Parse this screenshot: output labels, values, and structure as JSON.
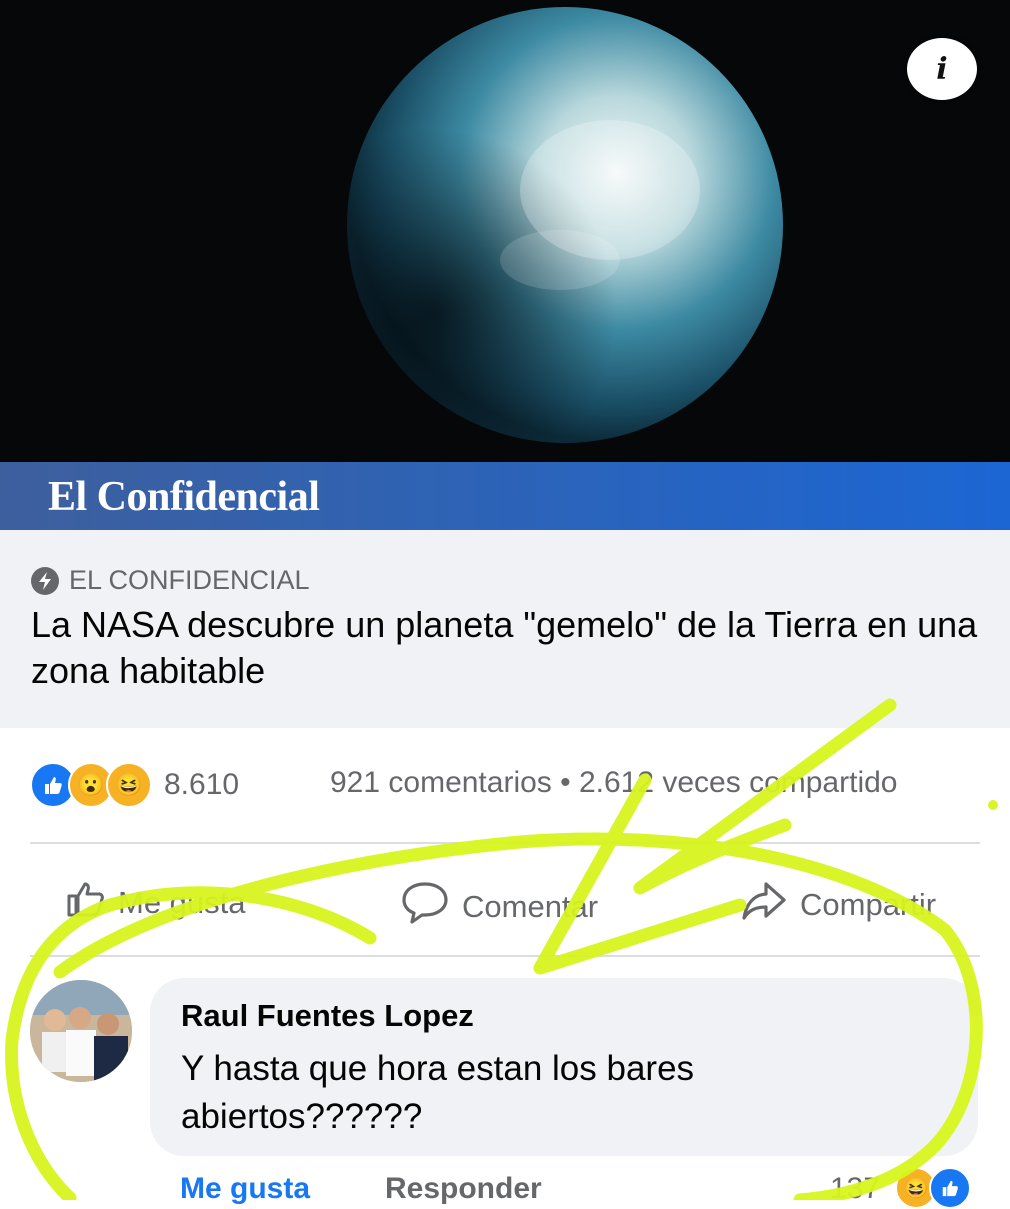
{
  "hero": {
    "info_label": "i"
  },
  "brand": {
    "name": "El Confidencial"
  },
  "link": {
    "source": "EL CONFIDENCIAL",
    "headline": "La NASA descubre un planeta \"gemelo\" de la Tierra en una zona habitable"
  },
  "stats": {
    "reaction_icons": [
      "like-icon",
      "wow-icon",
      "haha-icon"
    ],
    "reaction_count": "8.610",
    "summary": "921 comentarios • 2.612 veces compartido"
  },
  "actions": {
    "like": "Me gusta",
    "comment": "Comentar",
    "share": "Compartir"
  },
  "comment": {
    "author": "Raul Fuentes Lopez",
    "text": "Y hasta que hora estan los bares abiertos??????",
    "like_label": "Me gusta",
    "reply_label": "Responder",
    "reaction_count": "137"
  },
  "colors": {
    "facebook_blue": "#1877f2",
    "brand_bar": "#2e63b5",
    "highlighter": "#d7f51e"
  }
}
